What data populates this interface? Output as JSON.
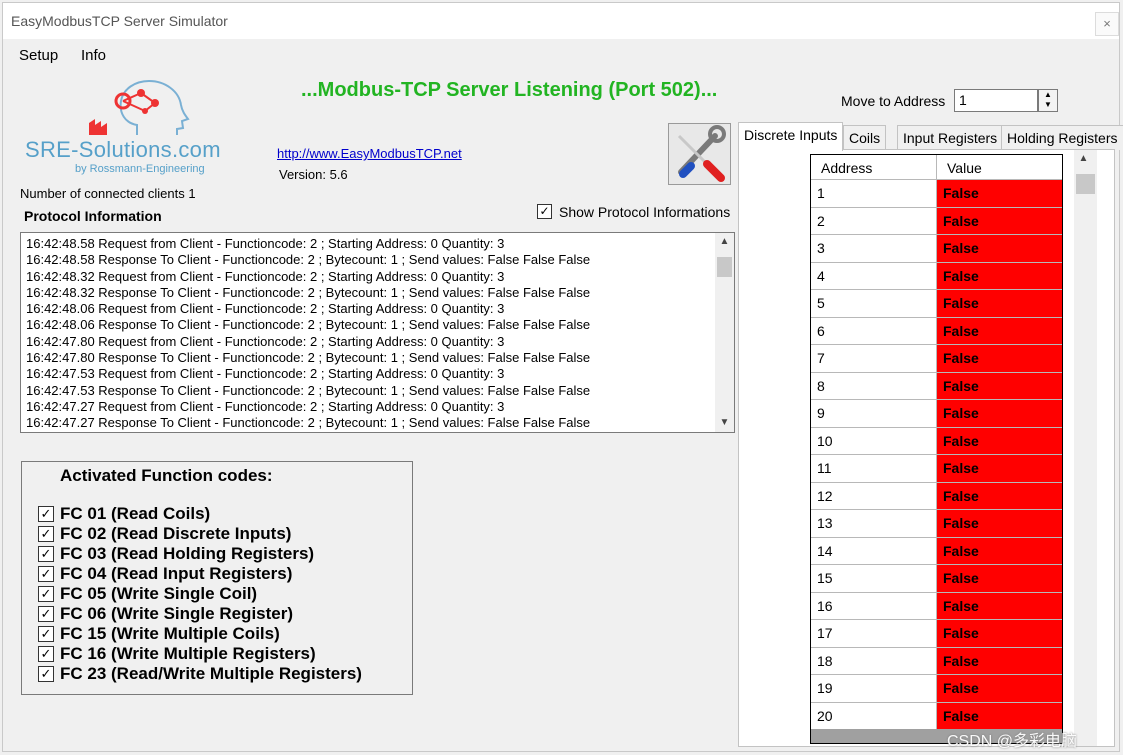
{
  "window": {
    "title": "EasyModbusTCP Server Simulator",
    "close_glyph": "×"
  },
  "menu": [
    "Setup",
    "Info"
  ],
  "logo": {
    "text": "SRE-Solutions.com",
    "subtitle": "by Rossmann-Engineering"
  },
  "status": "...Modbus-TCP Server Listening (Port 502)...",
  "link": "http://www.EasyModbusTCP.net",
  "version": "Version: 5.6",
  "clients": "Number of connected clients 1",
  "protocol_label": "Protocol Information",
  "show_protocol": {
    "label": "Show Protocol Informations",
    "checked": true
  },
  "log_lines": [
    "16:42:48.58 Request from Client - Functioncode: 2 ; Starting Address: 0 Quantity: 3",
    "16:42:48.58 Response To Client - Functioncode: 2 ; Bytecount: 1 ; Send values: False False False",
    "16:42:48.32 Request from Client - Functioncode: 2 ; Starting Address: 0 Quantity: 3",
    "16:42:48.32 Response To Client - Functioncode: 2 ; Bytecount: 1 ; Send values: False False False",
    "16:42:48.06 Request from Client - Functioncode: 2 ; Starting Address: 0 Quantity: 3",
    "16:42:48.06 Response To Client - Functioncode: 2 ; Bytecount: 1 ; Send values: False False False",
    "16:42:47.80 Request from Client - Functioncode: 2 ; Starting Address: 0 Quantity: 3",
    "16:42:47.80 Response To Client - Functioncode: 2 ; Bytecount: 1 ; Send values: False False False",
    "16:42:47.53 Request from Client - Functioncode: 2 ; Starting Address: 0 Quantity: 3",
    "16:42:47.53 Response To Client - Functioncode: 2 ; Bytecount: 1 ; Send values: False False False",
    "16:42:47.27 Request from Client - Functioncode: 2 ; Starting Address: 0 Quantity: 3",
    "16:42:47.27 Response To Client - Functioncode: 2 ; Bytecount: 1 ; Send values: False False False"
  ],
  "function_codes": {
    "title": "Activated Function codes:",
    "items": [
      "FC 01 (Read Coils)",
      "FC 02 (Read Discrete Inputs)",
      "FC 03 (Read Holding Registers)",
      "FC 04 (Read Input Registers)",
      "FC 05 (Write Single Coil)",
      "FC 06 (Write Single Register)",
      "FC 15 (Write Multiple Coils)",
      "FC 16 (Write Multiple Registers)",
      "FC 23 (Read/Write Multiple Registers)"
    ]
  },
  "move_to_address": {
    "label": "Move to Address",
    "value": "1"
  },
  "tabs": [
    "Discrete Inputs",
    "Coils",
    "Input Registers",
    "Holding Registers"
  ],
  "grid": {
    "headers": [
      "Address",
      "Value"
    ],
    "rows": [
      {
        "address": "1",
        "value": "False"
      },
      {
        "address": "2",
        "value": "False"
      },
      {
        "address": "3",
        "value": "False"
      },
      {
        "address": "4",
        "value": "False"
      },
      {
        "address": "5",
        "value": "False"
      },
      {
        "address": "6",
        "value": "False"
      },
      {
        "address": "7",
        "value": "False"
      },
      {
        "address": "8",
        "value": "False"
      },
      {
        "address": "9",
        "value": "False"
      },
      {
        "address": "10",
        "value": "False"
      },
      {
        "address": "11",
        "value": "False"
      },
      {
        "address": "12",
        "value": "False"
      },
      {
        "address": "13",
        "value": "False"
      },
      {
        "address": "14",
        "value": "False"
      },
      {
        "address": "15",
        "value": "False"
      },
      {
        "address": "16",
        "value": "False"
      },
      {
        "address": "17",
        "value": "False"
      },
      {
        "address": "18",
        "value": "False"
      },
      {
        "address": "19",
        "value": "False"
      },
      {
        "address": "20",
        "value": "False"
      }
    ]
  },
  "watermark": "CSDN @多彩电脑",
  "colors": {
    "status_green": "#22b422",
    "false_red": "#ff0000",
    "logo_blue": "#56a0c9",
    "link_blue": "#0000cc"
  },
  "icons": {
    "scroll_up": "▲",
    "scroll_down": "▼",
    "check": "✓"
  }
}
